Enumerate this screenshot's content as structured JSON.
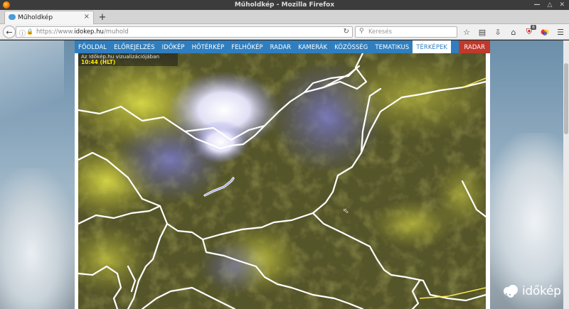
{
  "window": {
    "title": "Műholdkép - Mozilla Firefox"
  },
  "tab": {
    "title": "Műholdkép",
    "close": "×",
    "newtab": "+"
  },
  "nav": {
    "url_prefix": "https://www.",
    "url_host": "idokep.hu",
    "url_path": "/muhold",
    "search_placeholder": "Keresés",
    "notification_count": "6"
  },
  "site": {
    "menu": [
      "FŐOLDAL",
      "ELŐREJELZÉS",
      "IDŐKÉP",
      "HŐTÉRKÉP",
      "FELHŐKÉP",
      "RADAR",
      "KAMERÁK",
      "KÖZÖSSÉG",
      "TEMATIKUS",
      "TÉRKÉPEK"
    ],
    "active_menu": "TÉRKÉPEK",
    "radar": "RADAR",
    "caption_line1": "Az Időkép.hu vizualizációjában",
    "caption_line2": "10:44 (HLT)",
    "logo_text": "időkép"
  },
  "colors": {
    "menu_bg": "#2f7fc0",
    "radar_bg": "#c0392b",
    "caption_time": "#ffea00",
    "border_line": "#ffffff"
  }
}
